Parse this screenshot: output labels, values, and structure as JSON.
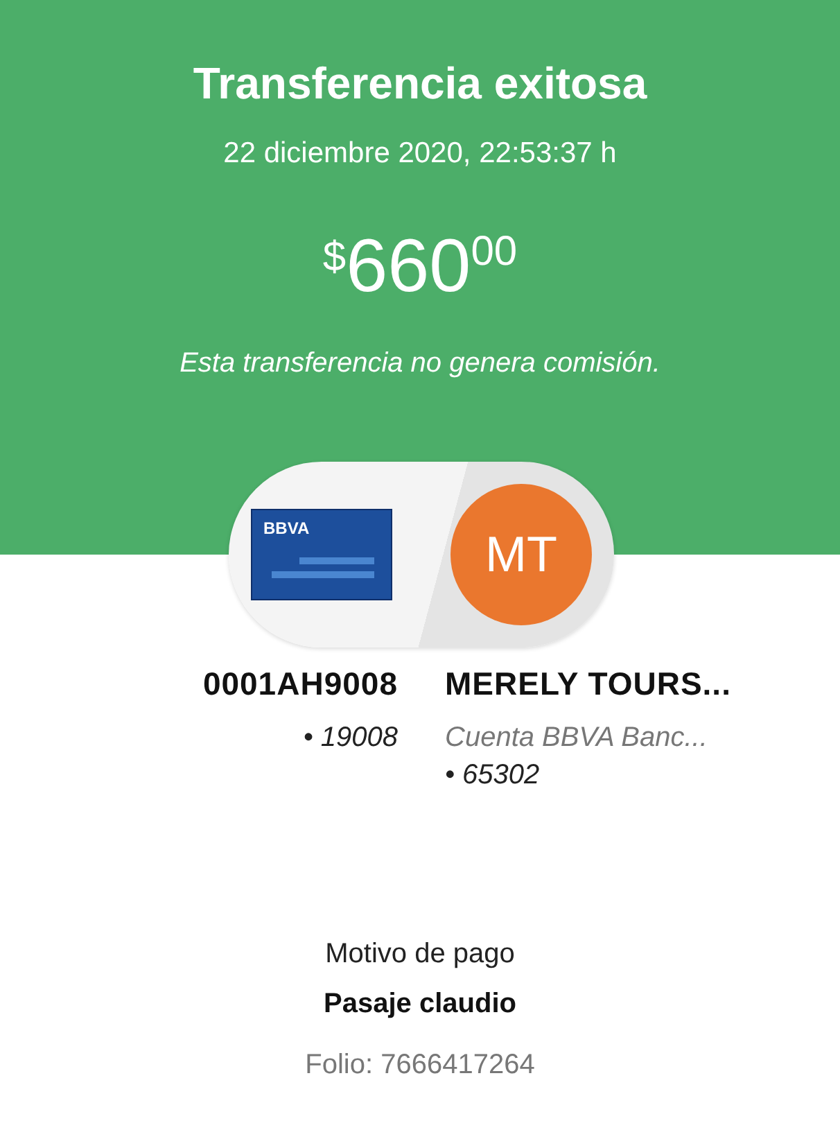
{
  "header": {
    "title": "Transferencia exitosa",
    "date": "22 diciembre 2020, 22:53:37 h",
    "amount": {
      "currency": "$",
      "whole": "660",
      "cents": "00"
    },
    "note": "Esta transferencia no genera comisión."
  },
  "transfer": {
    "card_logo": "BBVA",
    "recipient_initials": "MT"
  },
  "origin": {
    "account": "0001AH9008",
    "detail": "• 19008"
  },
  "destination": {
    "name": "MERELY TOURS...",
    "bank": "Cuenta BBVA Banc...",
    "detail": "• 65302"
  },
  "payment": {
    "label": "Motivo de pago",
    "concept": "Pasaje claudio",
    "folio": "Folio: 7666417264"
  }
}
